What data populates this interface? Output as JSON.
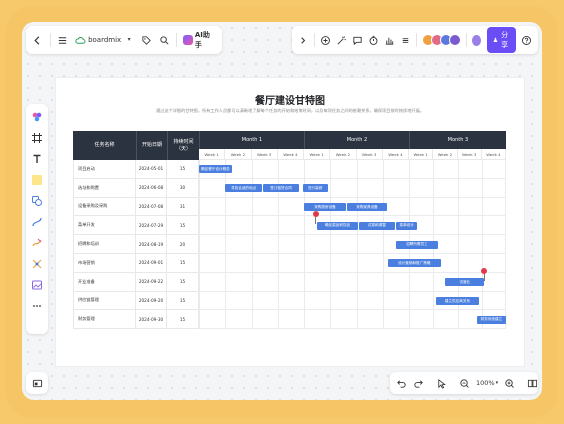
{
  "app": {
    "logo_text": "boardmix",
    "ai_label": "AI助手",
    "share_label": "分享",
    "zoom": "100%",
    "accent": "#6a4df5"
  },
  "icons_top_left": [
    "back-icon",
    "menu-icon",
    "cloud-icon",
    "tag-icon",
    "search-icon"
  ],
  "icons_top_right": [
    "collapse-icon",
    "plus-circle-icon",
    "magic-icon",
    "comment-icon",
    "timer-icon",
    "chart-icon",
    "expand-icon",
    "help-icon"
  ],
  "document": {
    "title": "餐厅建设甘特图",
    "subtitle": "通过这个详细的甘特图，所有工作人员都可以清晰地了解每个任务的开始和结束时间，以及每项任务之间的依赖关系，确保项目按时按质地开展。"
  },
  "gantt": {
    "header": {
      "task": "任务名称",
      "start": "开始日期",
      "duration": "持续时间（天）",
      "months": [
        "Month 1",
        "Month 2",
        "Month 3"
      ],
      "weeks": [
        "Week 1",
        "Week 2",
        "Week 3",
        "Week 4",
        "Week 1",
        "Week 2",
        "Week 3",
        "Week 4",
        "Week 1",
        "Week 2",
        "Week 3",
        "Week 4"
      ]
    },
    "rows": [
      {
        "task": "项目启动",
        "start": "2024-05-01",
        "duration": "15"
      },
      {
        "task": "选址和购置",
        "start": "2024-06-08",
        "duration": "30"
      },
      {
        "task": "设备采购及采购",
        "start": "2024-07-08",
        "duration": "31"
      },
      {
        "task": "菜单开发",
        "start": "2024-07-29",
        "duration": "15"
      },
      {
        "task": "招聘和培训",
        "start": "2024-08-19",
        "duration": "20"
      },
      {
        "task": "市场营销",
        "start": "2024-09-01",
        "duration": "15"
      },
      {
        "task": "开业准备",
        "start": "2024-09-22",
        "duration": "15"
      },
      {
        "task": "供应链管理",
        "start": "2024-09-20",
        "duration": "15"
      },
      {
        "task": "财务管理",
        "start": "2024-09-30",
        "duration": "15"
      }
    ],
    "bars": [
      {
        "row": 0,
        "start_week": 0.0,
        "weeks": 1.25,
        "label": "确定餐厅设计概念"
      },
      {
        "row": 1,
        "start_week": 1.0,
        "weeks": 1.4,
        "label": "寻找合适的地点"
      },
      {
        "row": 1,
        "start_week": 2.45,
        "weeks": 1.35,
        "label": "签订租赁合同"
      },
      {
        "row": 1,
        "start_week": 3.95,
        "weeks": 0.95,
        "label": "进行装修"
      },
      {
        "row": 2,
        "start_week": 4.0,
        "weeks": 1.6,
        "label": "采购厨房设备"
      },
      {
        "row": 2,
        "start_week": 5.65,
        "weeks": 1.5,
        "label": "采购家具设备"
      },
      {
        "row": 3,
        "start_week": 4.5,
        "weeks": 1.55,
        "label": "确定菜品和饮品"
      },
      {
        "row": 3,
        "start_week": 6.1,
        "weeks": 1.35,
        "label": "试菜和调整"
      },
      {
        "row": 3,
        "start_week": 7.5,
        "weeks": 0.85,
        "label": "菜单设计"
      },
      {
        "row": 4,
        "start_week": 7.5,
        "weeks": 1.7,
        "label": "招聘所需员工"
      },
      {
        "row": 5,
        "start_week": 7.2,
        "weeks": 2.1,
        "label": "设计营销和推广策略"
      },
      {
        "row": 6,
        "start_week": 9.5,
        "weeks": 1.6,
        "label": "试营业"
      },
      {
        "row": 7,
        "start_week": 9.1,
        "weeks": 1.8,
        "label": "建立供应商关系"
      },
      {
        "row": 8,
        "start_week": 10.8,
        "weeks": 1.35,
        "label": "财务系统建立"
      }
    ],
    "milestones": [
      {
        "row": 3,
        "week": 4.45,
        "color": "#e03a4a"
      },
      {
        "row": 6,
        "week": 11.1,
        "color": "#e03a4a"
      }
    ]
  }
}
